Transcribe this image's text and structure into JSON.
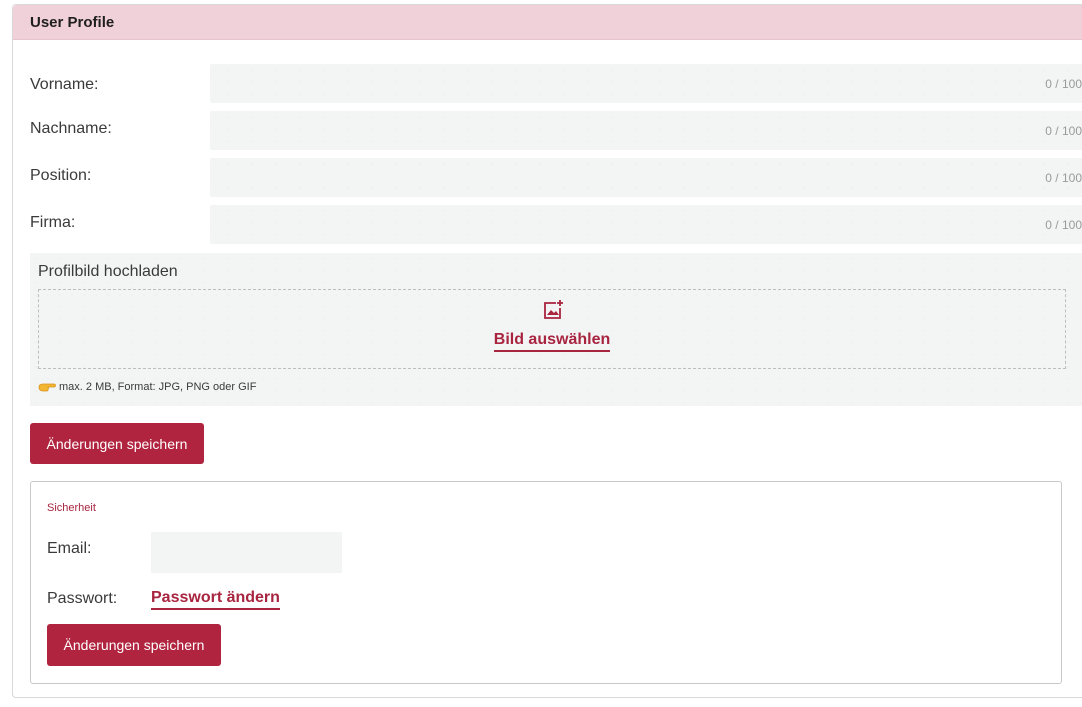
{
  "header": {
    "title": "User Profile"
  },
  "fields": [
    {
      "label": "Vorname:",
      "counter": "0 / 100"
    },
    {
      "label": "Nachname:",
      "counter": "0 / 100"
    },
    {
      "label": "Position:",
      "counter": "0 / 100"
    },
    {
      "label": "Firma:",
      "counter": "0 / 100"
    }
  ],
  "upload": {
    "title": "Profilbild hochladen",
    "icon": "add-image-icon",
    "choose_label": "Bild auswählen",
    "hint_icon": "pointing-hand-icon",
    "hint": "max. 2 MB, Format: JPG, PNG oder GIF"
  },
  "profile_save_label": "Änderungen speichern",
  "security": {
    "title": "Sicherheit",
    "email_label": "Email:",
    "email_value": "",
    "password_label": "Passwort:",
    "password_link": "Passwort ändern",
    "save_label": "Änderungen speichern"
  },
  "colors": {
    "accent": "#b0243f",
    "header_bg": "#f0d0d9",
    "input_bg": "#f3f5f5"
  }
}
